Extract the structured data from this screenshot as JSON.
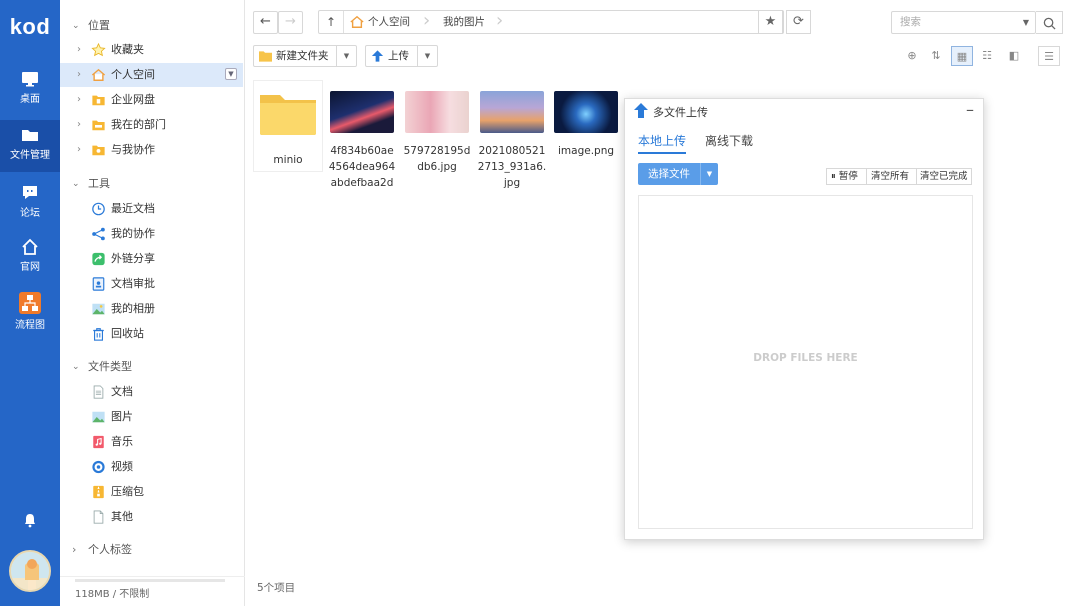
{
  "rail": {
    "logo": "kod",
    "items": [
      {
        "label": "桌面",
        "icon": "monitor-icon"
      },
      {
        "label": "文件管理",
        "icon": "folder-icon"
      },
      {
        "label": "论坛",
        "icon": "chat-icon"
      },
      {
        "label": "官网",
        "icon": "home-icon"
      },
      {
        "label": "流程图",
        "icon": "flowchart-icon"
      }
    ],
    "bell_icon": "bell-icon",
    "avatar_icon": "avatar-icon"
  },
  "tree": {
    "position_label": "位置",
    "position_items": [
      {
        "label": "收藏夹",
        "icon": "star-icon"
      },
      {
        "label": "个人空间",
        "icon": "home-folder-icon"
      },
      {
        "label": "企业网盘",
        "icon": "enterprise-folder-icon"
      },
      {
        "label": "我在的部门",
        "icon": "department-folder-icon"
      },
      {
        "label": "与我协作",
        "icon": "collab-folder-icon"
      }
    ],
    "tools_label": "工具",
    "tools_items": [
      {
        "label": "最近文档",
        "icon": "clock-icon"
      },
      {
        "label": "我的协作",
        "icon": "share-nodes-icon"
      },
      {
        "label": "外链分享",
        "icon": "link-share-icon"
      },
      {
        "label": "文档审批",
        "icon": "approval-icon"
      },
      {
        "label": "我的相册",
        "icon": "album-icon"
      },
      {
        "label": "回收站",
        "icon": "trash-icon"
      }
    ],
    "types_label": "文件类型",
    "types_items": [
      {
        "label": "文档",
        "icon": "document-icon"
      },
      {
        "label": "图片",
        "icon": "image-icon"
      },
      {
        "label": "音乐",
        "icon": "music-icon"
      },
      {
        "label": "视频",
        "icon": "video-icon"
      },
      {
        "label": "压缩包",
        "icon": "zip-icon"
      },
      {
        "label": "其他",
        "icon": "other-file-icon"
      }
    ],
    "tags_label": "个人标签",
    "quota": "118MB / 不限制"
  },
  "toolbar": {
    "breadcrumbs": [
      "个人空间",
      "我的图片"
    ],
    "search_placeholder": "搜索",
    "new_folder_label": "新建文件夹",
    "upload_label": "上传"
  },
  "files": [
    {
      "name": "minio",
      "kind": "folder"
    },
    {
      "name": "4f834b60ae4564dea964abdefbaa2d",
      "kind": "image"
    },
    {
      "name": "579728195ddb6.jpg",
      "kind": "image"
    },
    {
      "name": "20210805212713_931a6.jpg",
      "kind": "image"
    },
    {
      "name": "image.png",
      "kind": "image"
    }
  ],
  "status": {
    "count_text": "5个项目"
  },
  "dialog": {
    "title": "多文件上传",
    "tab_local": "本地上传",
    "tab_offline": "离线下载",
    "choose_files": "选择文件",
    "pause": "暂停",
    "clear_all": "清空所有",
    "clear_done": "清空已完成",
    "drop_text": "DROP FILES HERE"
  },
  "colors": {
    "rail": "#2566c7",
    "accent": "#2a7ad8",
    "selected": "#dce9fa"
  }
}
